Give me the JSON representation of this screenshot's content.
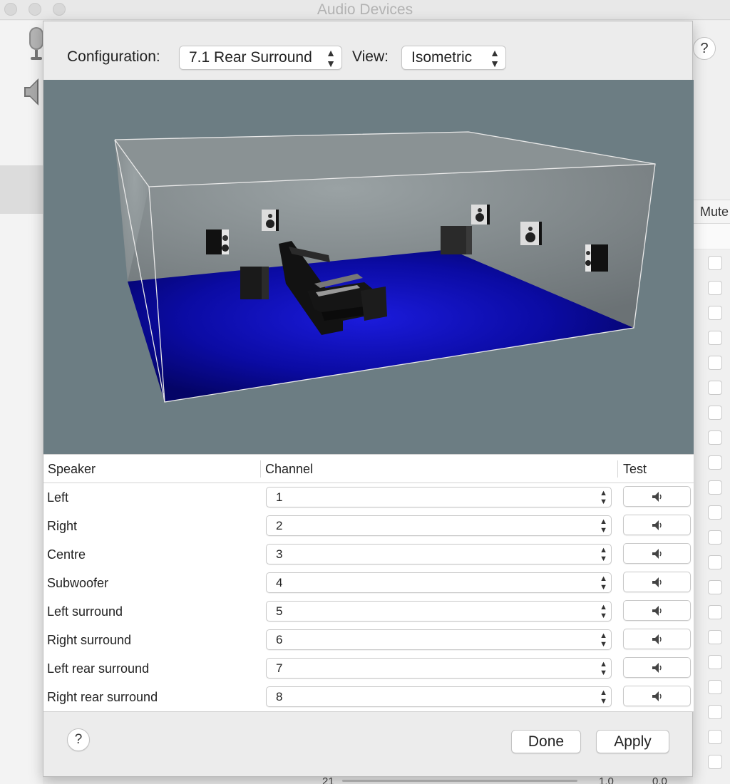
{
  "window": {
    "title": "Audio Devices",
    "help_label": "?",
    "mute_header": "Mute"
  },
  "toolbar": {
    "configuration_label": "Configuration:",
    "configuration_value": "7.1 Rear Surround",
    "view_label": "View:",
    "view_value": "Isometric"
  },
  "table": {
    "headers": {
      "speaker": "Speaker",
      "channel": "Channel",
      "test": "Test"
    },
    "rows": [
      {
        "speaker": "Left",
        "channel": "1"
      },
      {
        "speaker": "Right",
        "channel": "2"
      },
      {
        "speaker": "Centre",
        "channel": "3"
      },
      {
        "speaker": "Subwoofer",
        "channel": "4"
      },
      {
        "speaker": "Left surround",
        "channel": "5"
      },
      {
        "speaker": "Right surround",
        "channel": "6"
      },
      {
        "speaker": "Left rear surround",
        "channel": "7"
      },
      {
        "speaker": "Right rear surround",
        "channel": "8"
      }
    ],
    "test_icon": "speaker-icon"
  },
  "footer": {
    "help_label": "?",
    "done_label": "Done",
    "apply_label": "Apply"
  },
  "background": {
    "bottom_left_value": "21",
    "bottom_mid_value": "1.0",
    "bottom_right_value": "0.0"
  },
  "colors": {
    "viewport_bg": "#6c7d83",
    "floor": "#0a0a9e",
    "accent": "#ffffff"
  }
}
